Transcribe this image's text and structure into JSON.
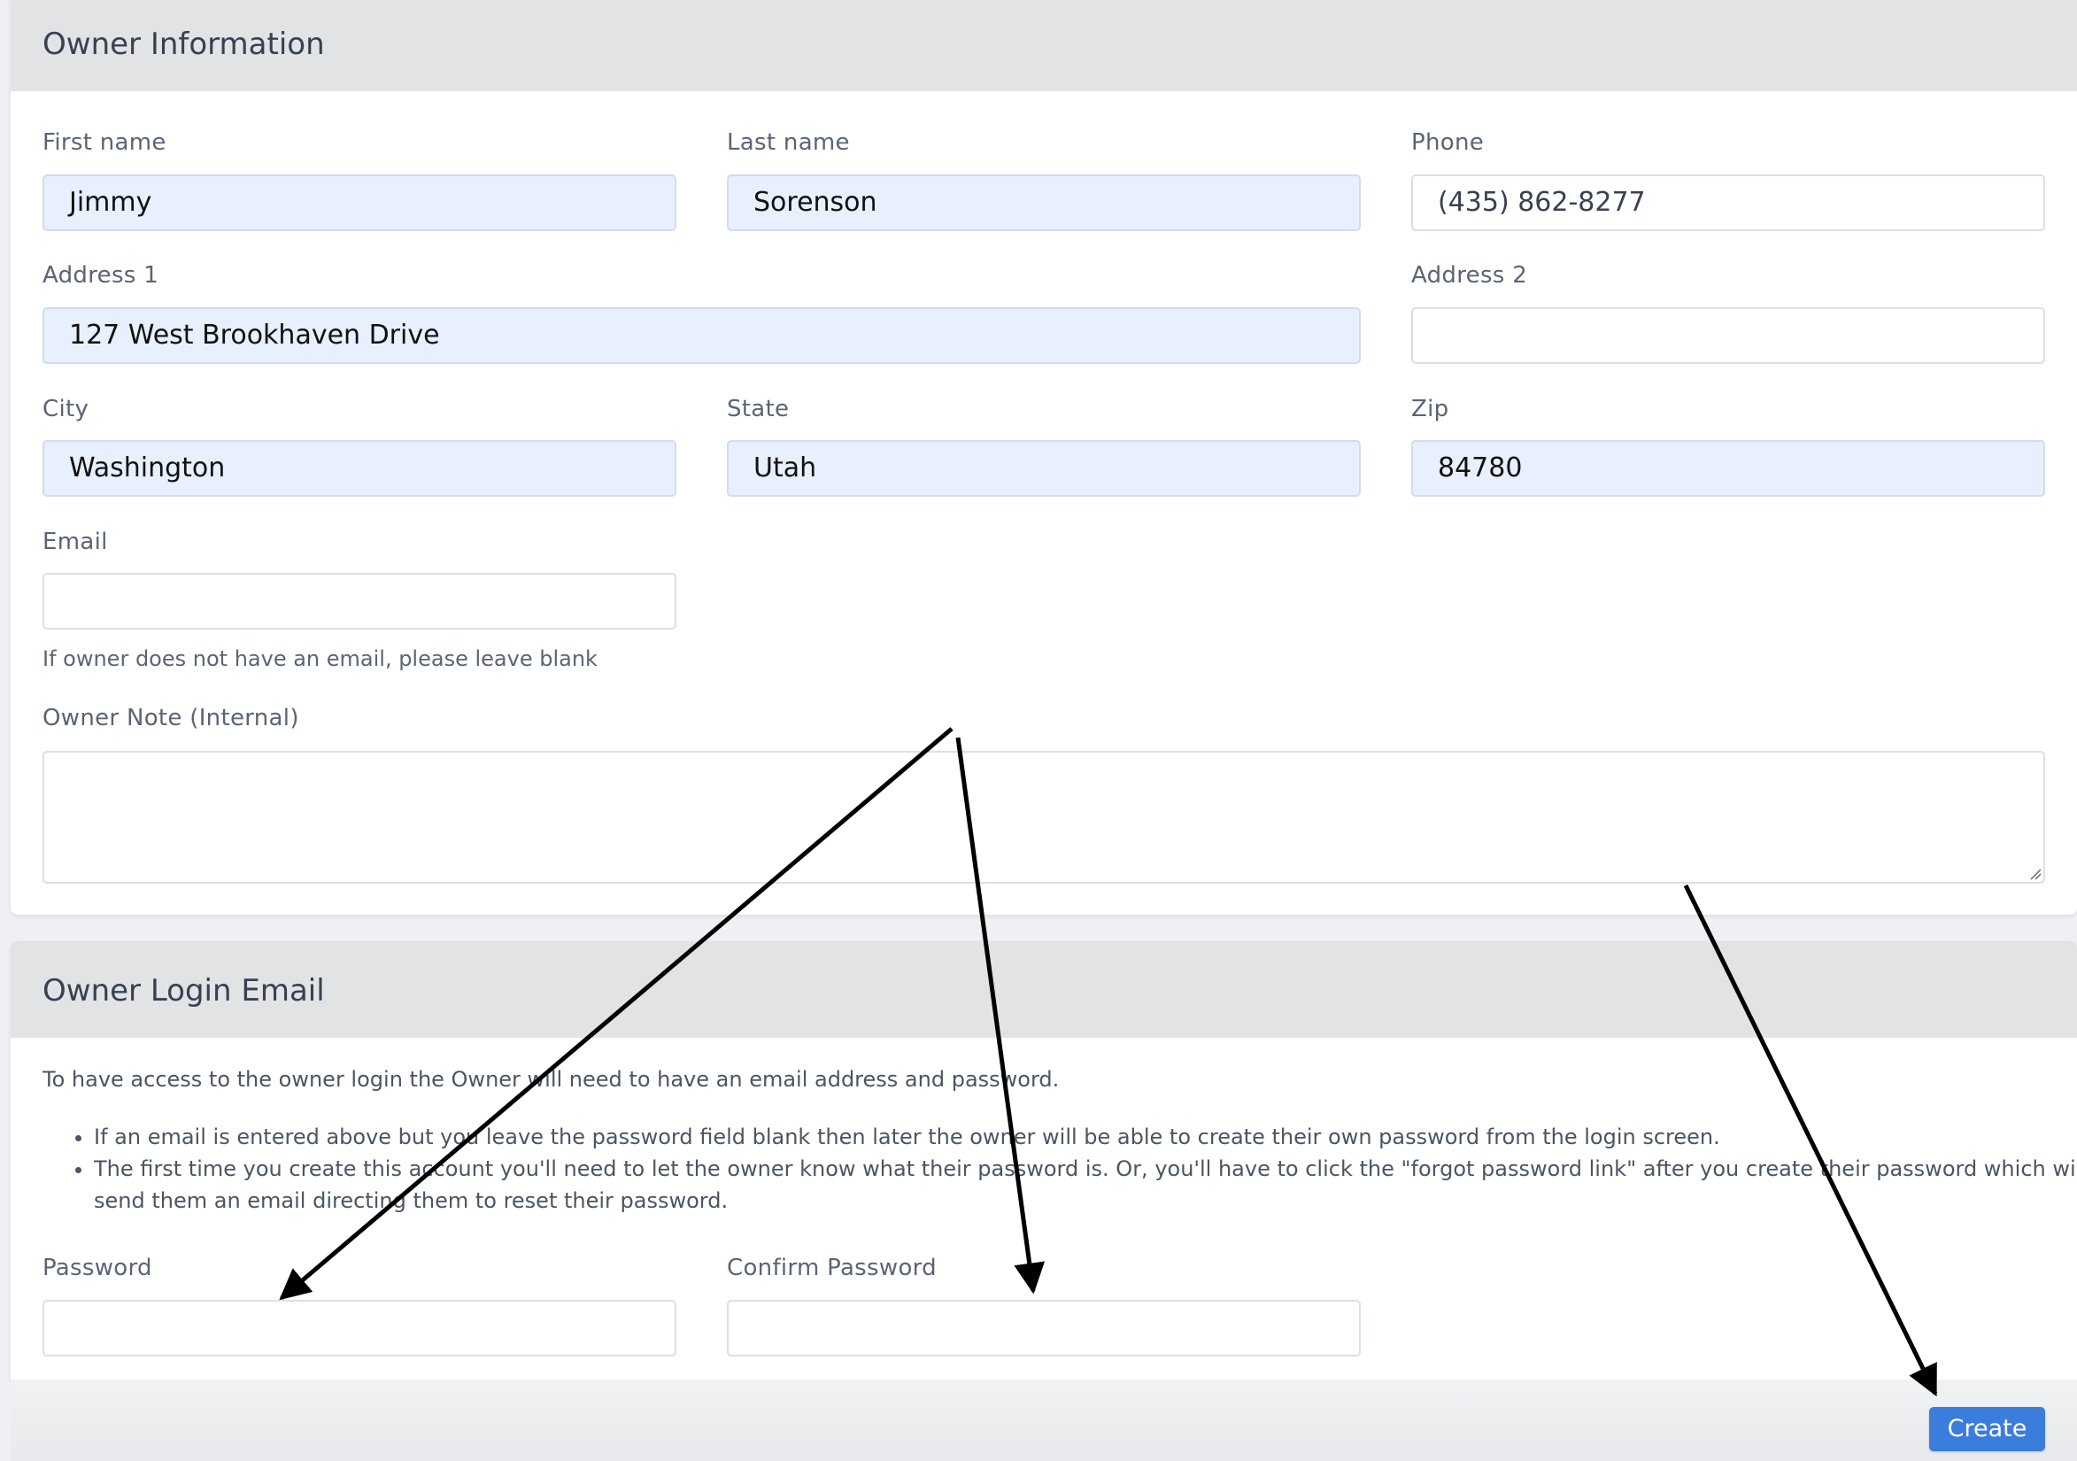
{
  "owner_info": {
    "title": "Owner Information",
    "first_name": {
      "label": "First name",
      "value": "Jimmy"
    },
    "last_name": {
      "label": "Last name",
      "value": "Sorenson"
    },
    "phone": {
      "label": "Phone",
      "value": "(435) 862-8277"
    },
    "address1": {
      "label": "Address 1",
      "value": "127 West Brookhaven Drive"
    },
    "address2": {
      "label": "Address 2",
      "value": ""
    },
    "city": {
      "label": "City",
      "value": "Washington"
    },
    "state": {
      "label": "State",
      "value": "Utah"
    },
    "zip": {
      "label": "Zip",
      "value": "84780"
    },
    "email": {
      "label": "Email",
      "value": "",
      "help": "If owner does not have an email, please leave blank"
    },
    "note": {
      "label": "Owner Note (Internal)",
      "value": ""
    }
  },
  "login": {
    "title": "Owner Login Email",
    "intro": "To have access to the owner login the Owner will need to have an email address and password.",
    "bullets": [
      "If an email is entered above but you leave the password field blank then later the owner will be able to create their own password from the login screen.",
      "The first time you create this account you'll need to let the owner know what their password is. Or, you'll have to click the \"forgot password link\" after you create their password which will send them an email directing them to reset their password."
    ],
    "password": {
      "label": "Password",
      "value": ""
    },
    "confirm_password": {
      "label": "Confirm Password",
      "value": ""
    }
  },
  "actions": {
    "create_label": "Create"
  },
  "colors": {
    "accent": "#3b7ddd",
    "autofill_bg": "#e8f0fe",
    "header_bg": "#e2e3e5",
    "annotation": "#000000"
  },
  "annotations": {
    "type": "arrow-overlay",
    "count": 3
  }
}
